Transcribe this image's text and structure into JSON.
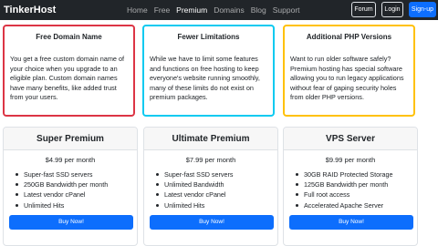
{
  "navbar": {
    "brand": "TinkerHost",
    "links": [
      "Home",
      "Free",
      "Premium",
      "Domains",
      "Blog",
      "Support"
    ],
    "buttons": {
      "forum": "Forum",
      "login": "Login",
      "signup": "Sign-up"
    }
  },
  "features": [
    {
      "title": "Free Domain Name",
      "text": "You get a free custom domain name of your choice when you upgrade to an eligible plan. Custom domain names have many benefits, like added trust from your users."
    },
    {
      "title": "Fewer Limitations",
      "text": "While we have to limit some features and functions on free hosting to keep everyone's website running smoothly, many of these limits do not exist on premium packages."
    },
    {
      "title": "Additional PHP Versions",
      "text": "Want to run older software safely? Premium hosting has special software allowing you to run legacy applications without fear of gaping security holes from older PHP versions."
    }
  ],
  "plans": [
    {
      "name": "Super Premium",
      "price": "$4.99 per month",
      "features": [
        "Super-fast SSD servers",
        "250GB Bandwidth per month",
        "Latest vendor cPanel",
        "Unlimited Hits"
      ],
      "button": "Buy Now!"
    },
    {
      "name": "Ultimate Premium",
      "price": "$7.99 per month",
      "features": [
        "Super-fast SSD servers",
        "Unlimited Bandwidth",
        "Latest vendor cPanel",
        "Unlimited Hits"
      ],
      "button": "Buy Now!"
    },
    {
      "name": "VPS Server",
      "price": "$9.99 per month",
      "features": [
        "30GB RAID Protected Storage",
        "125GB Bandwidth per month",
        "Full root access",
        "Accelerated Apache Server"
      ],
      "button": "Buy Now!"
    }
  ],
  "colors": {
    "navbar": "#212529",
    "primary": "#0d6efd",
    "danger": "#dc3545",
    "info": "#0dcaf0",
    "warning": "#ffc107"
  }
}
